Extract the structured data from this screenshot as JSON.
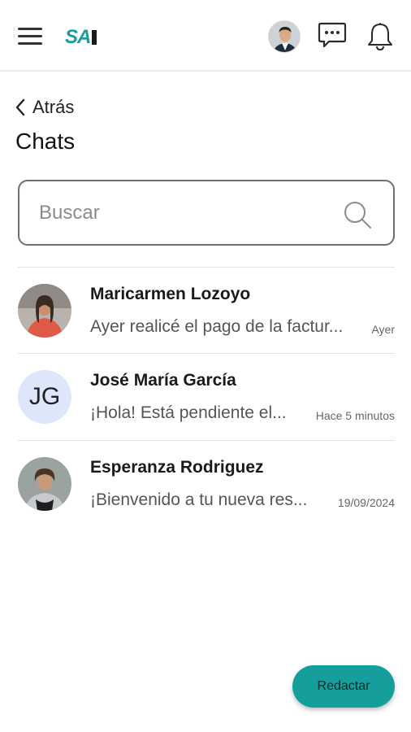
{
  "header": {
    "logo_text": "SA",
    "icons": [
      "menu-icon",
      "user-avatar",
      "chat-bubble-icon",
      "bell-icon"
    ]
  },
  "nav": {
    "back_label": "Atrás",
    "page_title": "Chats"
  },
  "search": {
    "placeholder": "Buscar",
    "value": ""
  },
  "chats": [
    {
      "name": "Maricarmen Lozoyo",
      "preview": "Ayer realicé el pago de la factur...",
      "time": "Ayer",
      "avatar": "photo"
    },
    {
      "name": "José María García",
      "preview": "¡Hola! Está pendiente el...",
      "time": "Hace 5 minutos",
      "avatar": "initials",
      "initials": "JG"
    },
    {
      "name": "Esperanza Rodriguez",
      "preview": "¡Bienvenido a tu nueva res...",
      "time": "19/09/2024",
      "avatar": "photo"
    }
  ],
  "compose_button": {
    "label": "Redactar"
  },
  "colors": {
    "accent": "#149f9c",
    "initials_avatar_bg": "#dde6fb",
    "divider": "#e3e3e3"
  }
}
